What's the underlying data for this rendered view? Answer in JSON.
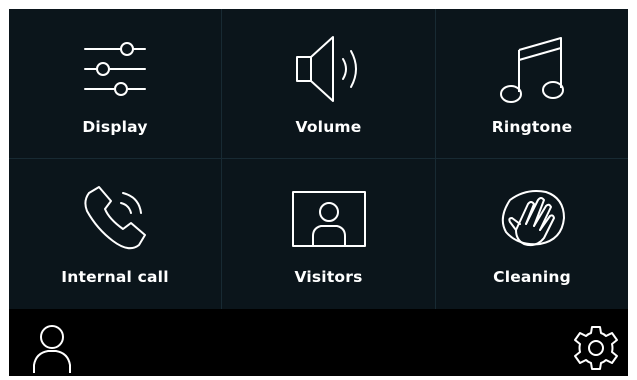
{
  "tiles": [
    {
      "label": "Display",
      "icon": "sliders-icon"
    },
    {
      "label": "Volume",
      "icon": "speaker-icon"
    },
    {
      "label": "Ringtone",
      "icon": "music-note-icon"
    },
    {
      "label": "Internal call",
      "icon": "phone-ringing-icon"
    },
    {
      "label": "Visitors",
      "icon": "visitor-portrait-icon"
    },
    {
      "label": "Cleaning",
      "icon": "hand-wipe-icon"
    }
  ],
  "bottom_bar": {
    "left_icon": "user-icon",
    "right_icon": "gear-icon"
  },
  "colors": {
    "background": "#0b151b",
    "divider": "#182a33",
    "bar": "#000000",
    "foreground": "#ffffff"
  }
}
